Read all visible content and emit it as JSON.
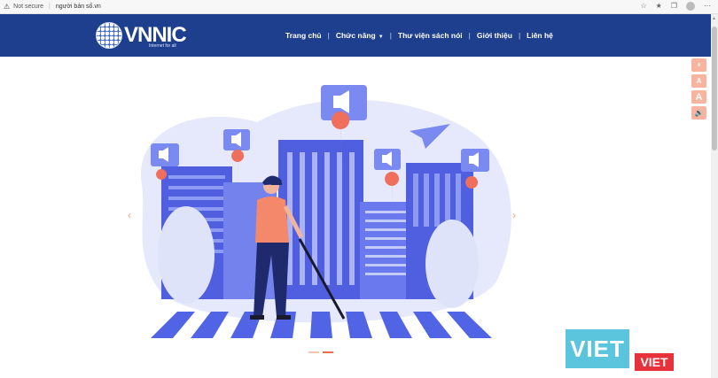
{
  "browser": {
    "security_icon": "warning-icon",
    "security_label": "Not secure",
    "url": "người bản số.vn"
  },
  "header": {
    "logo_vn": "VN",
    "logo_nic": "NIC",
    "logo_tagline": "Internet for all",
    "nav": [
      {
        "label": "Trang chủ"
      },
      {
        "label": "Chức năng"
      },
      {
        "label": "Thư viện sách nói"
      },
      {
        "label": "Giới thiệu"
      },
      {
        "label": "Liên hệ"
      }
    ]
  },
  "accessibility": {
    "btn1": "A",
    "btn2": "A",
    "btn3": "A",
    "btn4_icon": "speaker-icon"
  },
  "carousel": {
    "prev": "‹",
    "next": "›"
  },
  "watermark": {
    "viet": "VIET",
    "viet2": "VIET"
  },
  "colors": {
    "header_bg": "#1e3f8e",
    "accent": "#f8b49f",
    "illustration_blue": "#5b6ee8"
  }
}
